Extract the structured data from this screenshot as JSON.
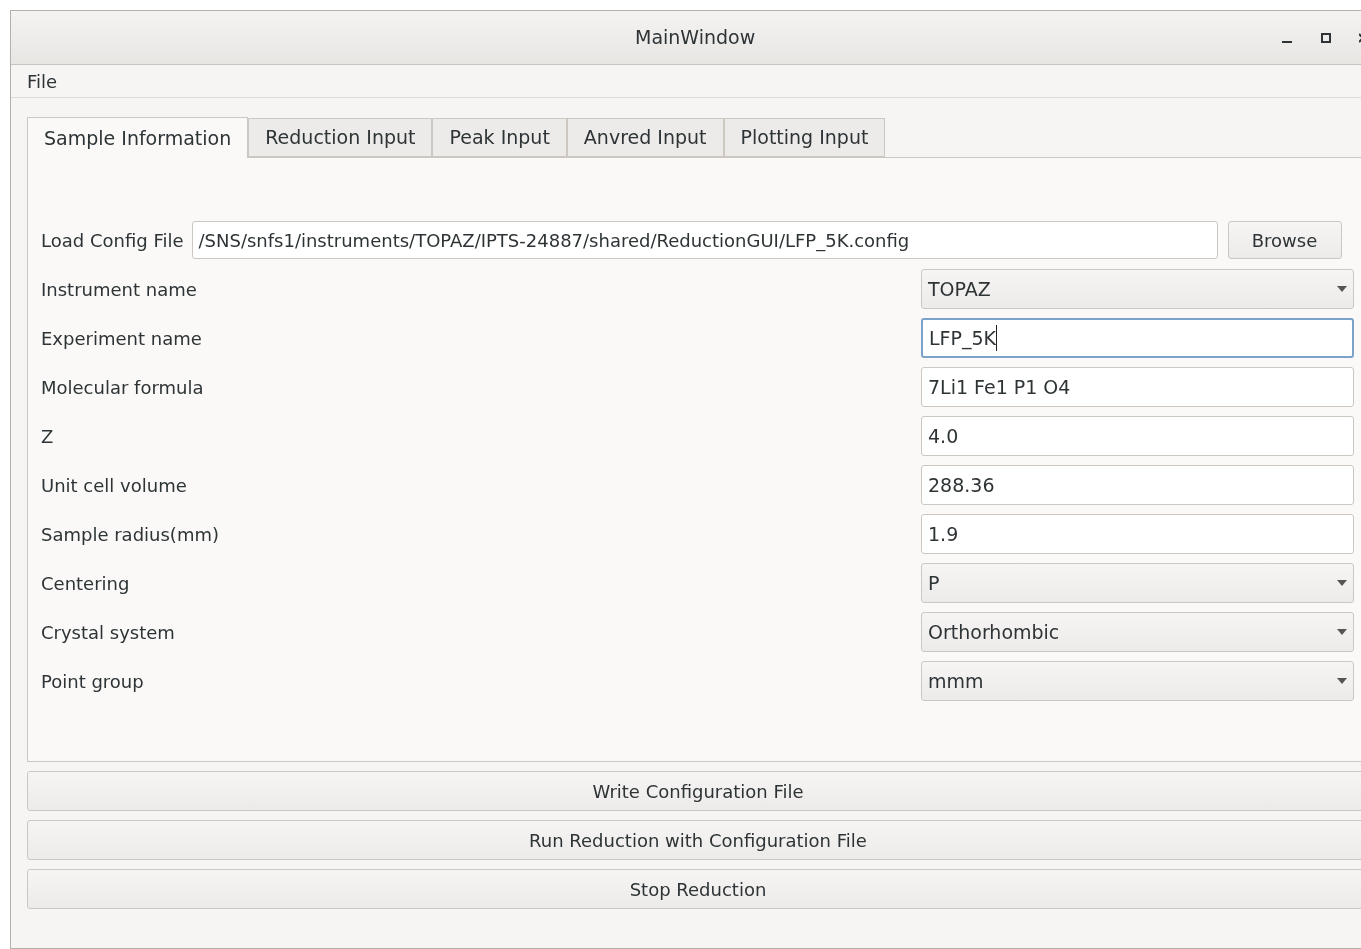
{
  "window": {
    "title": "MainWindow"
  },
  "menu": [
    "File"
  ],
  "tabs": [
    {
      "label": "Sample Information",
      "selected": true
    },
    {
      "label": "Reduction Input",
      "selected": false
    },
    {
      "label": "Peak Input",
      "selected": false
    },
    {
      "label": "Anvred Input",
      "selected": false
    },
    {
      "label": "Plotting Input",
      "selected": false
    }
  ],
  "config": {
    "label": "Load Config File",
    "value": "/SNS/snfs1/instruments/TOPAZ/IPTS-24887/shared/ReductionGUI/LFP_5K.config",
    "button": "Browse"
  },
  "fields": [
    {
      "label": "Instrument name",
      "kind": "dropdown",
      "value": "TOPAZ",
      "focused": false
    },
    {
      "label": "Experiment name",
      "kind": "text",
      "value": "LFP_5K",
      "focused": true
    },
    {
      "label": "Molecular formula",
      "kind": "text",
      "value": "7Li1 Fe1 P1 O4",
      "focused": false
    },
    {
      "label": "Z",
      "kind": "text",
      "value": "4.0",
      "focused": false
    },
    {
      "label": "Unit cell volume",
      "kind": "text",
      "value": "288.36",
      "focused": false
    },
    {
      "label": "Sample radius(mm)",
      "kind": "text",
      "value": "1.9",
      "focused": false
    },
    {
      "label": "Centering",
      "kind": "dropdown",
      "value": "P",
      "focused": false
    },
    {
      "label": "Crystal system",
      "kind": "dropdown",
      "value": "Orthorhombic",
      "focused": false
    },
    {
      "label": "Point group",
      "kind": "dropdown",
      "value": "mmm",
      "focused": false
    }
  ],
  "buttons": [
    "Write Configuration File",
    "Run Reduction with Configuration File",
    "Stop Reduction"
  ]
}
